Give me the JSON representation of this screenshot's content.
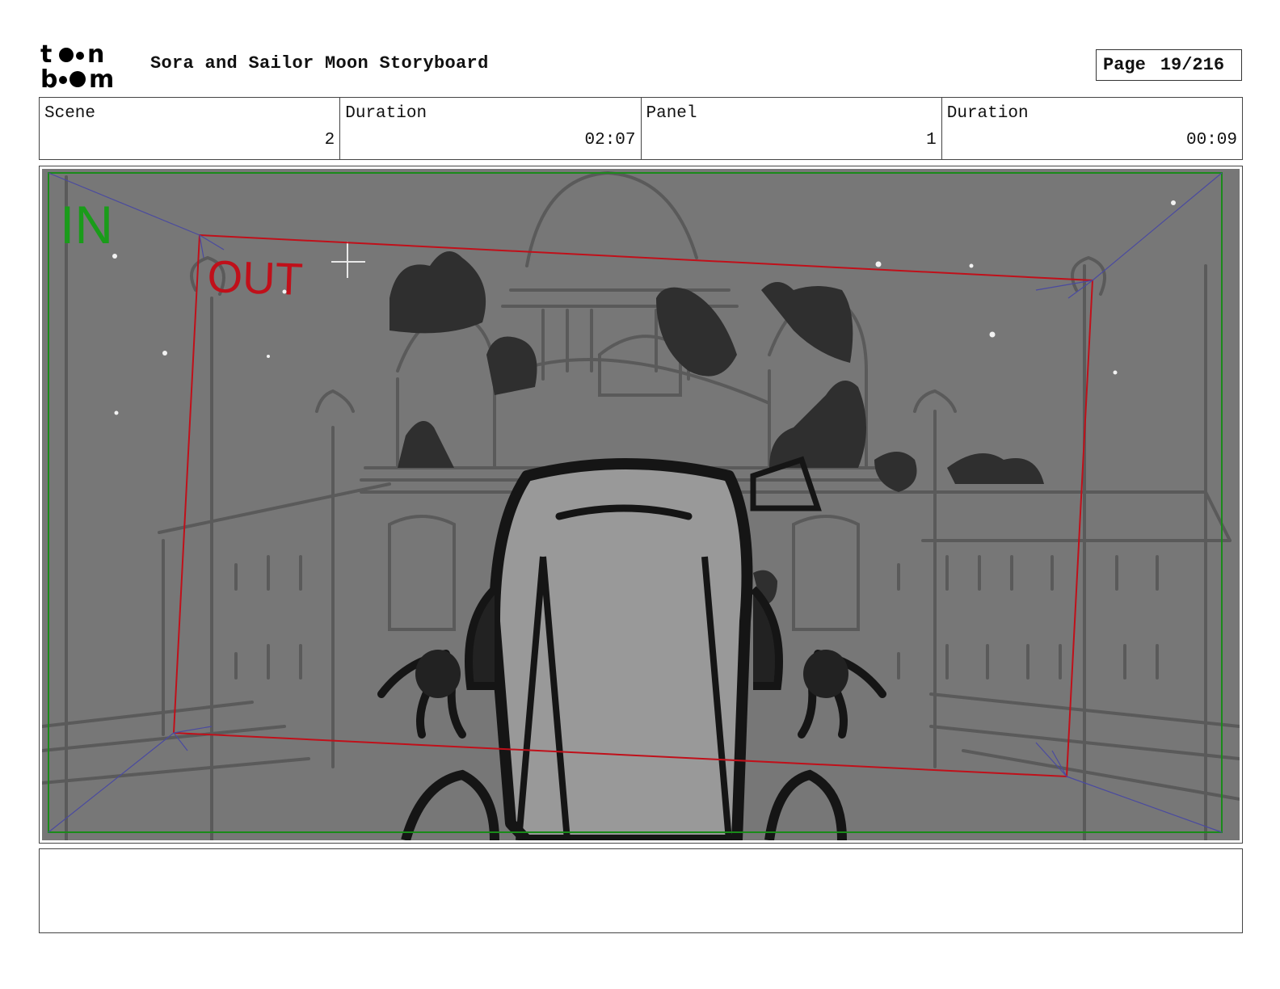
{
  "header": {
    "title": "Sora and Sailor Moon Storyboard",
    "page_label": "Page",
    "page_value": "19/216"
  },
  "info": {
    "scene_label": "Scene",
    "scene_value": "2",
    "scene_duration_label": "Duration",
    "scene_duration_value": "02:07",
    "panel_label": "Panel",
    "panel_value": "1",
    "panel_duration_label": "Duration",
    "panel_duration_value": "00:09"
  },
  "frame": {
    "in_label": "IN",
    "out_label": "OUT",
    "in_color": "#1a9c1a",
    "out_color": "#c0101a"
  },
  "notes": {
    "text": ""
  }
}
